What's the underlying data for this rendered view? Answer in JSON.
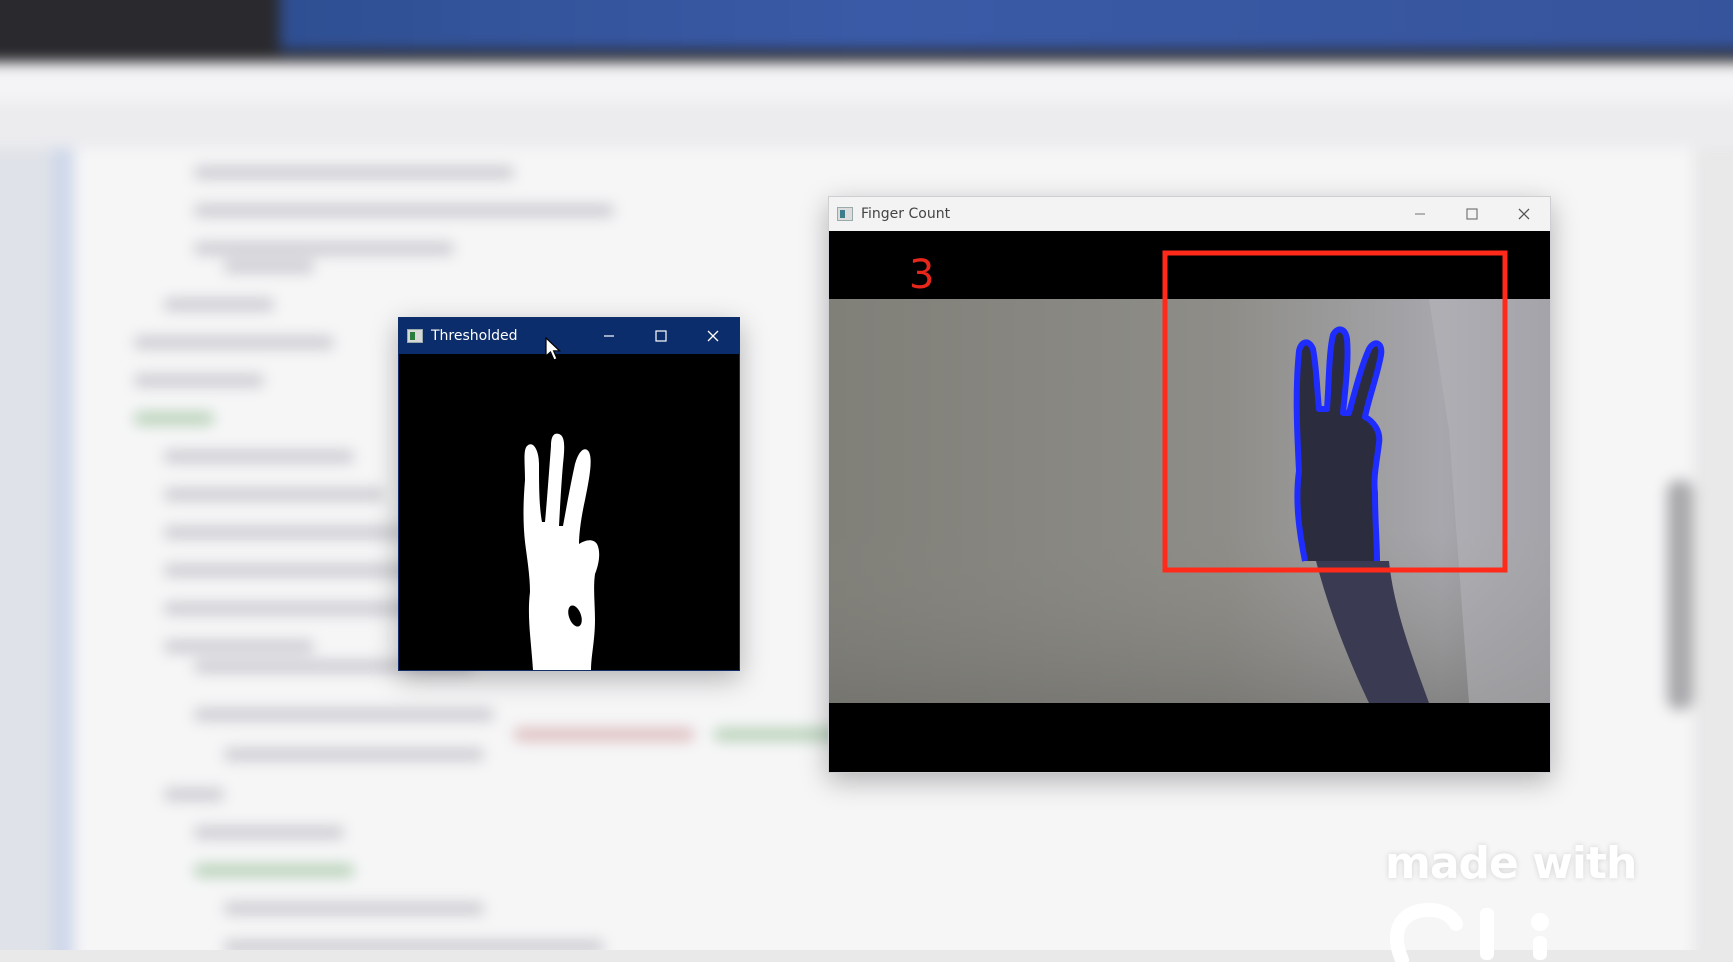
{
  "background": {
    "description_hidden": true,
    "accent_color": "#3a5aa7"
  },
  "thresholded_window": {
    "title": "Thresholded",
    "icon": "app-window-icon",
    "controls": [
      "minimize-icon",
      "maximize-icon",
      "close-icon"
    ]
  },
  "finger_count_window": {
    "title": "Finger Count",
    "icon": "app-window-icon",
    "controls": [
      "minimize-icon",
      "maximize-icon",
      "close-icon"
    ],
    "count": "3",
    "roi_color": "#ff2a1a",
    "contour_color": "#1f2cff"
  },
  "watermark": {
    "text": "made with"
  }
}
